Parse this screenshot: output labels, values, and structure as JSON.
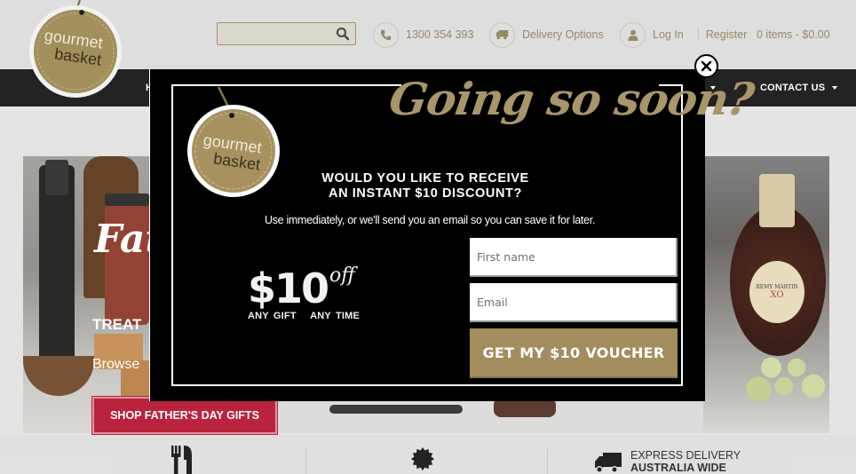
{
  "brand": {
    "logo_line1": "gourmet",
    "logo_line2": "basket",
    "gold": "#a38c5e",
    "red": "#b3112d"
  },
  "header": {
    "search": {
      "placeholder": "",
      "value": "",
      "icon": "search-icon"
    },
    "phone": {
      "icon": "phone-icon",
      "label": "1300 354 393"
    },
    "delivery": {
      "icon": "truck-icon",
      "label": "Delivery Options"
    },
    "account": {
      "icon": "user-icon",
      "login": "Log In",
      "register": "Register"
    },
    "cart": {
      "label": "0 items - $0.00"
    }
  },
  "nav": {
    "items": [
      {
        "label": "H"
      },
      {
        "label": ""
      },
      {
        "label": "CONTACT US"
      }
    ]
  },
  "hero": {
    "headline": "Fat",
    "treat": "TREAT",
    "browse": "Browse",
    "cta": "SHOP FATHER'S DAY GIFTS",
    "product_labels": {
      "cognac_brand": "REMY MARTIN",
      "cognac_grade": "XO"
    }
  },
  "features": {
    "items": [
      {
        "icon": "cutlery-icon"
      },
      {
        "icon": "badge-icon"
      },
      {
        "icon": "truck-icon",
        "line1": "EXPRESS DELIVERY",
        "line2": "AUSTRALIA WIDE"
      }
    ]
  },
  "modal": {
    "title": "Going so soon?",
    "logo_line1": "gourmet",
    "logo_line2": "basket",
    "question_line1": "WOULD YOU LIKE TO RECEIVE",
    "question_line2": "AN INSTANT $10 DISCOUNT?",
    "subtitle": "Use immediately, or we'll send you an email so you can save it for later.",
    "offer_amount": "$10",
    "offer_suffix": "off",
    "offer_tagline": "ANY GIFT   ANY TIME",
    "first_name_placeholder": "First name",
    "email_placeholder": "Email",
    "submit_label": "GET MY $10 VOUCHER",
    "close_icon": "close-icon"
  }
}
